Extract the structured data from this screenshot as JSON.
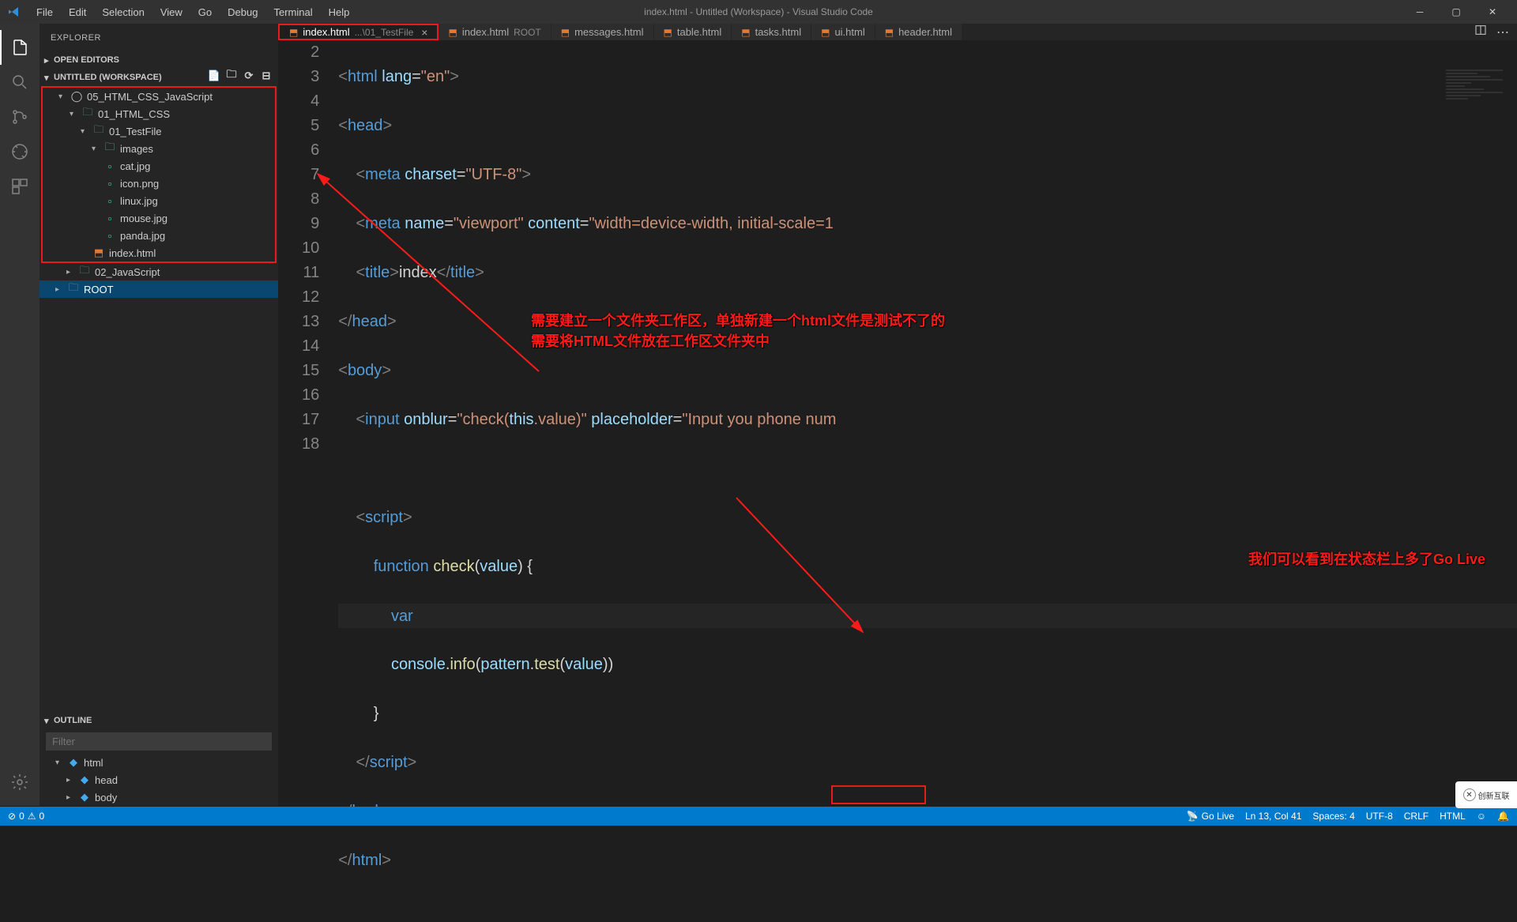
{
  "window": {
    "title": "index.html - Untitled (Workspace) - Visual Studio Code"
  },
  "menu": [
    "File",
    "Edit",
    "Selection",
    "View",
    "Go",
    "Debug",
    "Terminal",
    "Help"
  ],
  "explorer": {
    "header": "EXPLORER",
    "openEditors": "OPEN EDITORS",
    "workspace": "UNTITLED (WORKSPACE)",
    "tree": {
      "project": "05_HTML_CSS_JavaScript",
      "htmlcss": "01_HTML_CSS",
      "testfile": "01_TestFile",
      "images": "images",
      "files": [
        "cat.jpg",
        "icon.png",
        "linux.jpg",
        "mouse.jpg",
        "panda.jpg"
      ],
      "indexhtml": "index.html",
      "js": "02_JavaScript",
      "root": "ROOT"
    },
    "outline": "OUTLINE",
    "filter": "Filter",
    "outlineItems": [
      "html",
      "head",
      "body"
    ]
  },
  "tabs": [
    {
      "label": "index.html",
      "path": "...\\01_TestFile",
      "active": true,
      "closeVisible": true
    },
    {
      "label": "index.html",
      "path": "ROOT"
    },
    {
      "label": "messages.html"
    },
    {
      "label": "table.html"
    },
    {
      "label": "tasks.html"
    },
    {
      "label": "ui.html"
    },
    {
      "label": "header.html"
    }
  ],
  "editor": {
    "lineNumbers": [
      "2",
      "3",
      "4",
      "5",
      "6",
      "7",
      "8",
      "9",
      "10",
      "11",
      "12",
      "13",
      "14",
      "15",
      "16",
      "17",
      "18"
    ]
  },
  "annotations": {
    "text1": "需要建立一个文件夹工作区，单独新建一个html文件是测试不了的",
    "text2": "需要将HTML文件放在工作区文件夹中",
    "text3": "我们可以看到在状态栏上多了Go Live"
  },
  "statusBar": {
    "errors": "0",
    "warnings": "0",
    "goLive": "Go Live",
    "lncol": "Ln 13, Col 41",
    "spaces": "Spaces: 4",
    "encoding": "UTF-8",
    "eol": "CRLF",
    "lang": "HTML"
  },
  "watermark": "创新互联"
}
